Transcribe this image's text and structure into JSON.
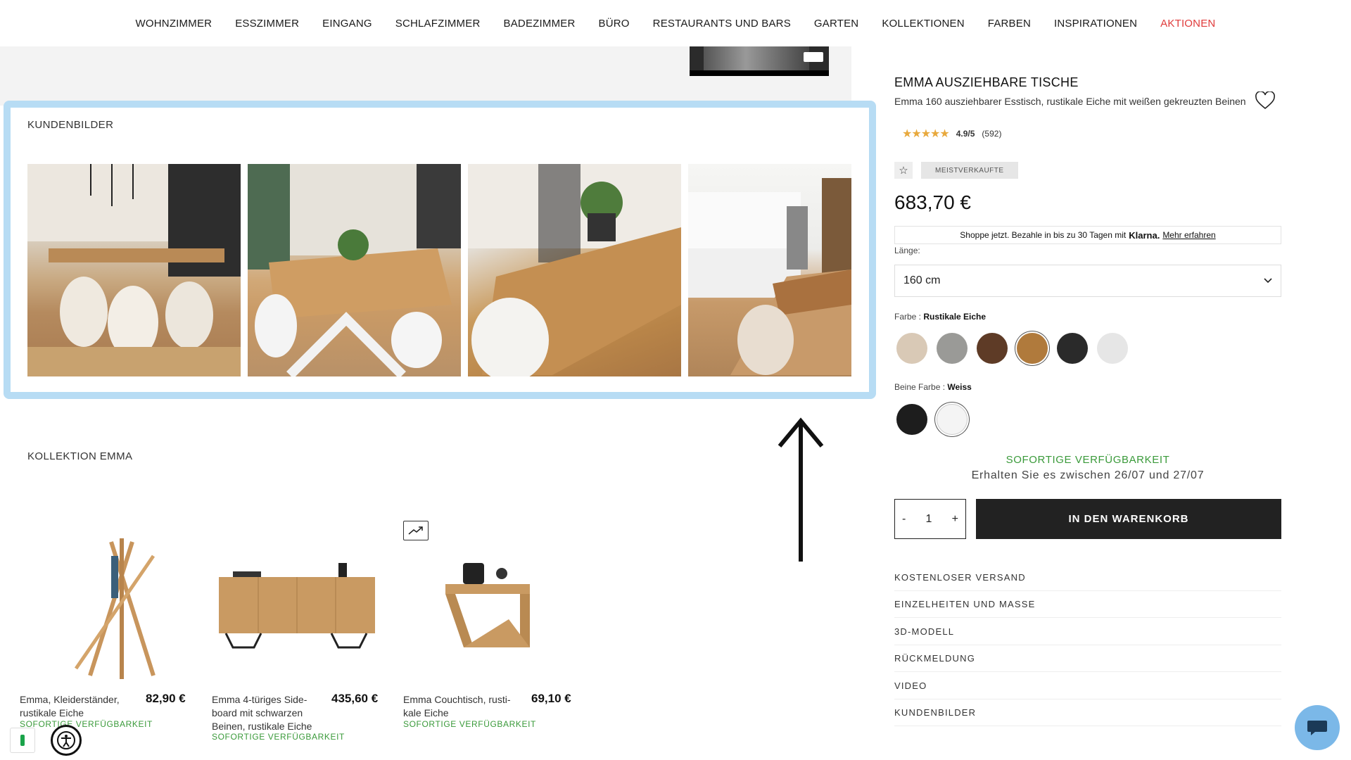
{
  "nav": {
    "items": [
      "WOHNZIMMER",
      "ESSZIMMER",
      "EINGANG",
      "SCHLAFZIMMER",
      "BADEZIMMER",
      "BÜRO",
      "RESTAURANTS UND BARS",
      "GARTEN",
      "KOLLEKTIONEN",
      "FARBEN",
      "INSPIRATIONEN",
      "AKTIONEN"
    ],
    "sale_color": "#e03b3b"
  },
  "customer_images": {
    "title": "KUNDENBILDER",
    "highlight_color": "#b7dcf4"
  },
  "collection": {
    "title": "KOLLEKTION EMMA",
    "products": [
      {
        "name": "Emma, Kleiderständer, rustikale Eiche",
        "price": "82,90 €",
        "availability": "SOFORTIGE VERFÜGBARKEIT"
      },
      {
        "name": "Emma 4-türiges Side-board mit schwarzen Beinen, rustikale Eiche",
        "price": "435,60 €",
        "availability": "SOFORTIGE VERFÜGBARKEIT"
      },
      {
        "name": "Emma Couchtisch, rusti-kale Eiche",
        "price": "69,10 €",
        "availability": "SOFORTIGE VERFÜGBARKEIT"
      }
    ]
  },
  "product": {
    "title": "EMMA AUSZIEHBARE TISCHE",
    "subtitle": "Emma 160 ausziehbarer Esstisch, rustikale Eiche mit weißen gekreuzten Beinen",
    "stars": "★★★★★",
    "rating": "4.9/5",
    "reviews": "(592)",
    "badge": "MEISTVERKAUFTE",
    "price": "683,70 €",
    "klarna": {
      "text": "Shoppe jetzt. Bezahle in bis zu 30 Tagen mit",
      "brand": "Klarna.",
      "link": "Mehr erfahren"
    },
    "length_label": "Länge:",
    "length_value": "160 cm",
    "color_label": "Farbe :",
    "color_value": "Rustikale Eiche",
    "color_swatches": [
      "#d9c9b6",
      "#9a9a97",
      "#5e3b26",
      "#b07a3c",
      "#2a2a2a",
      "#e6e6e6"
    ],
    "legs_label": "Beine Farbe :",
    "legs_value": "Weiss",
    "legs_swatches": [
      "#1d1d1d",
      "#f4f4f4"
    ],
    "availability": "SOFORTIGE VERFÜGBARKEIT",
    "delivery": "Erhalten Sie es zwischen 26/07 und 27/07",
    "qty": {
      "minus": "-",
      "value": "1",
      "plus": "+"
    },
    "cart_button": "IN DEN WARENKORB",
    "accordion": [
      "KOSTENLOSER VERSAND",
      "EINZELHEITEN UND MASSE",
      "3D-MODELL",
      "RÜCKMELDUNG",
      "VIDEO",
      "KUNDENBILDER"
    ]
  }
}
